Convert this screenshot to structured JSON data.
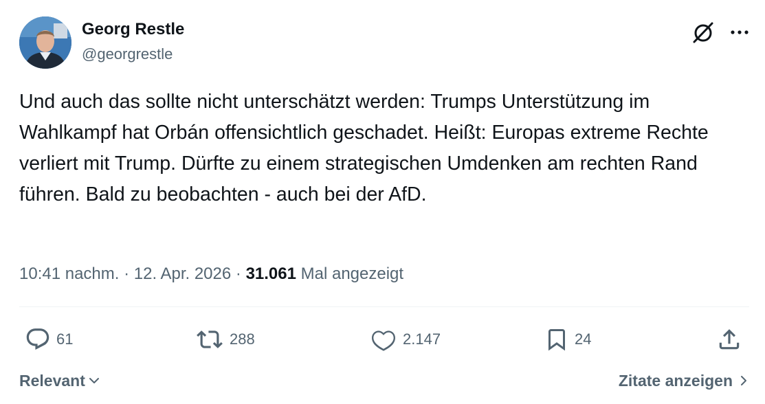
{
  "author": {
    "display_name": "Georg Restle",
    "handle": "@georgrestle"
  },
  "header_icons": [
    "grok-icon",
    "more-icon"
  ],
  "tweet": {
    "text": "Und auch das sollte nicht unterschätzt werden: Trumps Unterstützung im Wahlkampf hat Orbán offensichtlich geschadet. Heißt: Europas extreme Rechte verliert mit Trump. Dürfte zu einem strategischen Umdenken am rechten Rand führen. Bald zu beobachten - auch bei der AfD."
  },
  "meta": {
    "time": "10:41 nachm.",
    "separator": " · ",
    "date": "12. Apr. 2026",
    "views_count": "31.061",
    "views_label": "Mal angezeigt"
  },
  "actions": {
    "replies": "61",
    "reposts": "288",
    "likes": "2.147",
    "bookmarks": "24"
  },
  "footer": {
    "sort_label": "Relevant",
    "quotes_label": "Zitate anzeigen"
  },
  "colors": {
    "text_primary": "#0f1419",
    "text_secondary": "#536471",
    "divider": "#eff3f4"
  }
}
